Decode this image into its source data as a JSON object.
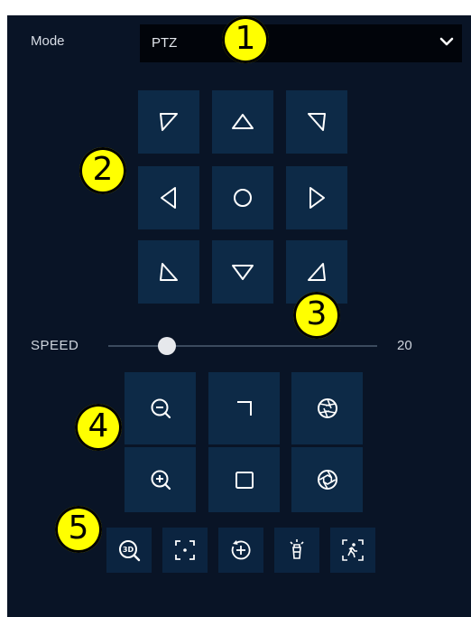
{
  "mode": {
    "label": "Mode",
    "selected": "PTZ"
  },
  "speed": {
    "label": "SPEED",
    "value": "20",
    "level": 0.2
  },
  "callouts": [
    "1",
    "2",
    "3",
    "4",
    "5"
  ],
  "icons": {
    "direction_pad": [
      "up-left-arrow-icon",
      "up-arrow-icon",
      "up-right-arrow-icon",
      "left-arrow-icon",
      "home-circle-icon",
      "right-arrow-icon",
      "down-left-arrow-icon",
      "down-arrow-icon",
      "down-right-arrow-icon"
    ],
    "lens": [
      "zoom-out-icon",
      "focus-near-icon",
      "iris-close-icon",
      "zoom-in-icon",
      "focus-far-icon",
      "iris-open-icon"
    ],
    "tools": [
      "3d-zoom-icon",
      "center-focus-icon",
      "preset-icon",
      "light-icon",
      "auto-tracking-icon"
    ]
  },
  "colors": {
    "panel": "#091426",
    "button": "#0d2a47",
    "callout": "#ffff00",
    "icon": "#ffffff"
  }
}
